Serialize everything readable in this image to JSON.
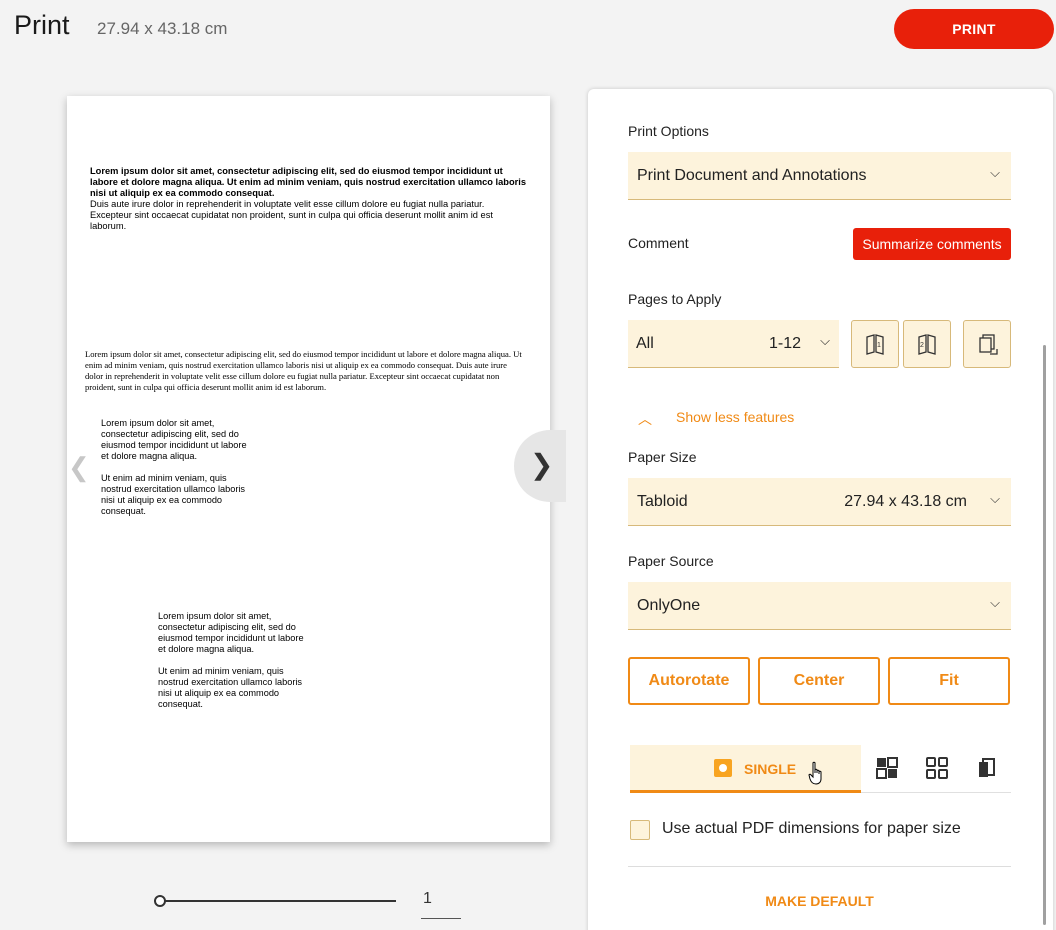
{
  "header": {
    "title": "Print",
    "dimensions": "27.94 x 43.18 cm",
    "print_label": "PRINT"
  },
  "preview": {
    "block1_bold": "Lorem ipsum dolor sit amet, consectetur adipiscing elit, sed do eiusmod tempor incididunt ut labore et dolore magna aliqua. Ut enim ad minim veniam, quis nostrud exercitation ullamco laboris nisi ut aliquip ex ea commodo consequat.",
    "block1_regular": "Duis aute irure dolor in reprehenderit in voluptate velit esse cillum dolore eu fugiat nulla pariatur. Excepteur sint occaecat cupidatat non proident, sunt in culpa qui officia deserunt mollit anim id est laborum.",
    "block2": "Lorem ipsum dolor sit amet, consectetur adipiscing elit, sed do eiusmod tempor incididunt ut labore et dolore magna aliqua. Ut enim ad minim veniam, quis nostrud exercitation ullamco laboris nisi ut aliquip ex ea commodo consequat. Duis aute irure dolor in reprehenderit in voluptate velit esse cillum dolore eu fugiat nulla pariatur. Excepteur sint occaecat cupidatat non proident, sunt in culpa qui officia deserunt mollit anim id est laborum.",
    "col_para1": "Lorem ipsum dolor sit amet, consectetur adipiscing elit, sed do eiusmod tempor incididunt ut labore et dolore magna aliqua.",
    "col_para2": "Ut enim ad minim veniam, quis nostrud exercitation ullamco laboris nisi ut aliquip ex ea commodo consequat.",
    "page_number": "1"
  },
  "options": {
    "print_options_label": "Print Options",
    "print_options_value": "Print Document and Annotations",
    "comment_label": "Comment",
    "summarize_label": "Summarize comments",
    "pages_label": "Pages to Apply",
    "pages_value": "All",
    "pages_range": "1-12",
    "show_less_label": "Show less features",
    "paper_size_label": "Paper Size",
    "paper_size_value": "Tabloid",
    "paper_size_dims": "27.94 x 43.18 cm",
    "paper_source_label": "Paper Source",
    "paper_source_value": "OnlyOne",
    "autorotate_label": "Autorotate",
    "center_label": "Center",
    "fit_label": "Fit",
    "single_label": "SINGLE",
    "actual_pdf_label": "Use actual PDF dimensions for paper size",
    "make_default_label": "MAKE DEFAULT"
  },
  "colors": {
    "accent": "#f08a16",
    "primary": "#e8200a",
    "field_bg": "#fdf3dc"
  },
  "icons": [
    "chevron-left-icon",
    "chevron-right-icon",
    "chevron-down-icon",
    "chevron-up-icon",
    "odd-pages-icon",
    "even-pages-icon",
    "reverse-pages-icon",
    "single-layout-icon",
    "booklet-layout-icon",
    "multiple-layout-icon",
    "poster-layout-icon",
    "hand-cursor-icon"
  ]
}
